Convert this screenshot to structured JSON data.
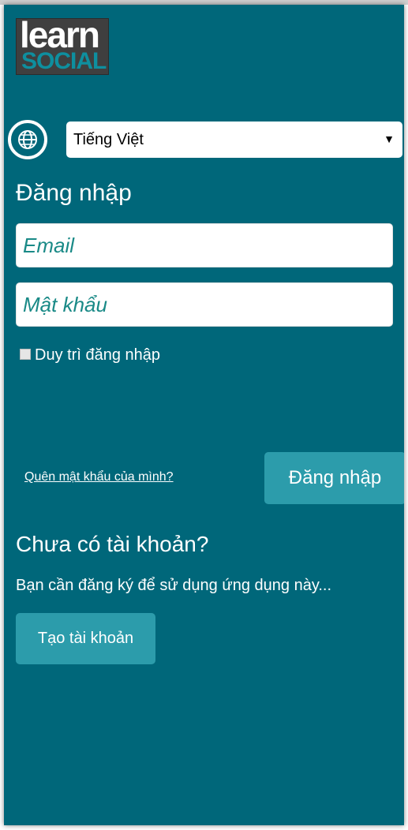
{
  "logo": {
    "line1": "learn",
    "line2": "SOCIAL"
  },
  "language": {
    "selected": "Tiếng Việt",
    "icon": "globe-icon"
  },
  "login": {
    "title": "Đăng nhập",
    "email_placeholder": "Email",
    "password_placeholder": "Mật khẩu",
    "remember_label": "Duy trì đăng nhập",
    "forgot_label": "Quên mật khẩu của mình?",
    "submit_label": "Đăng nhập"
  },
  "signup": {
    "heading": "Chưa có tài khoản?",
    "description": "Bạn cần đăng ký để sử dụng ứng dụng này...",
    "button_label": "Tạo tài khoản"
  },
  "colors": {
    "background": "#00677a",
    "button": "#2c9cab",
    "placeholder": "#1a8a87"
  }
}
